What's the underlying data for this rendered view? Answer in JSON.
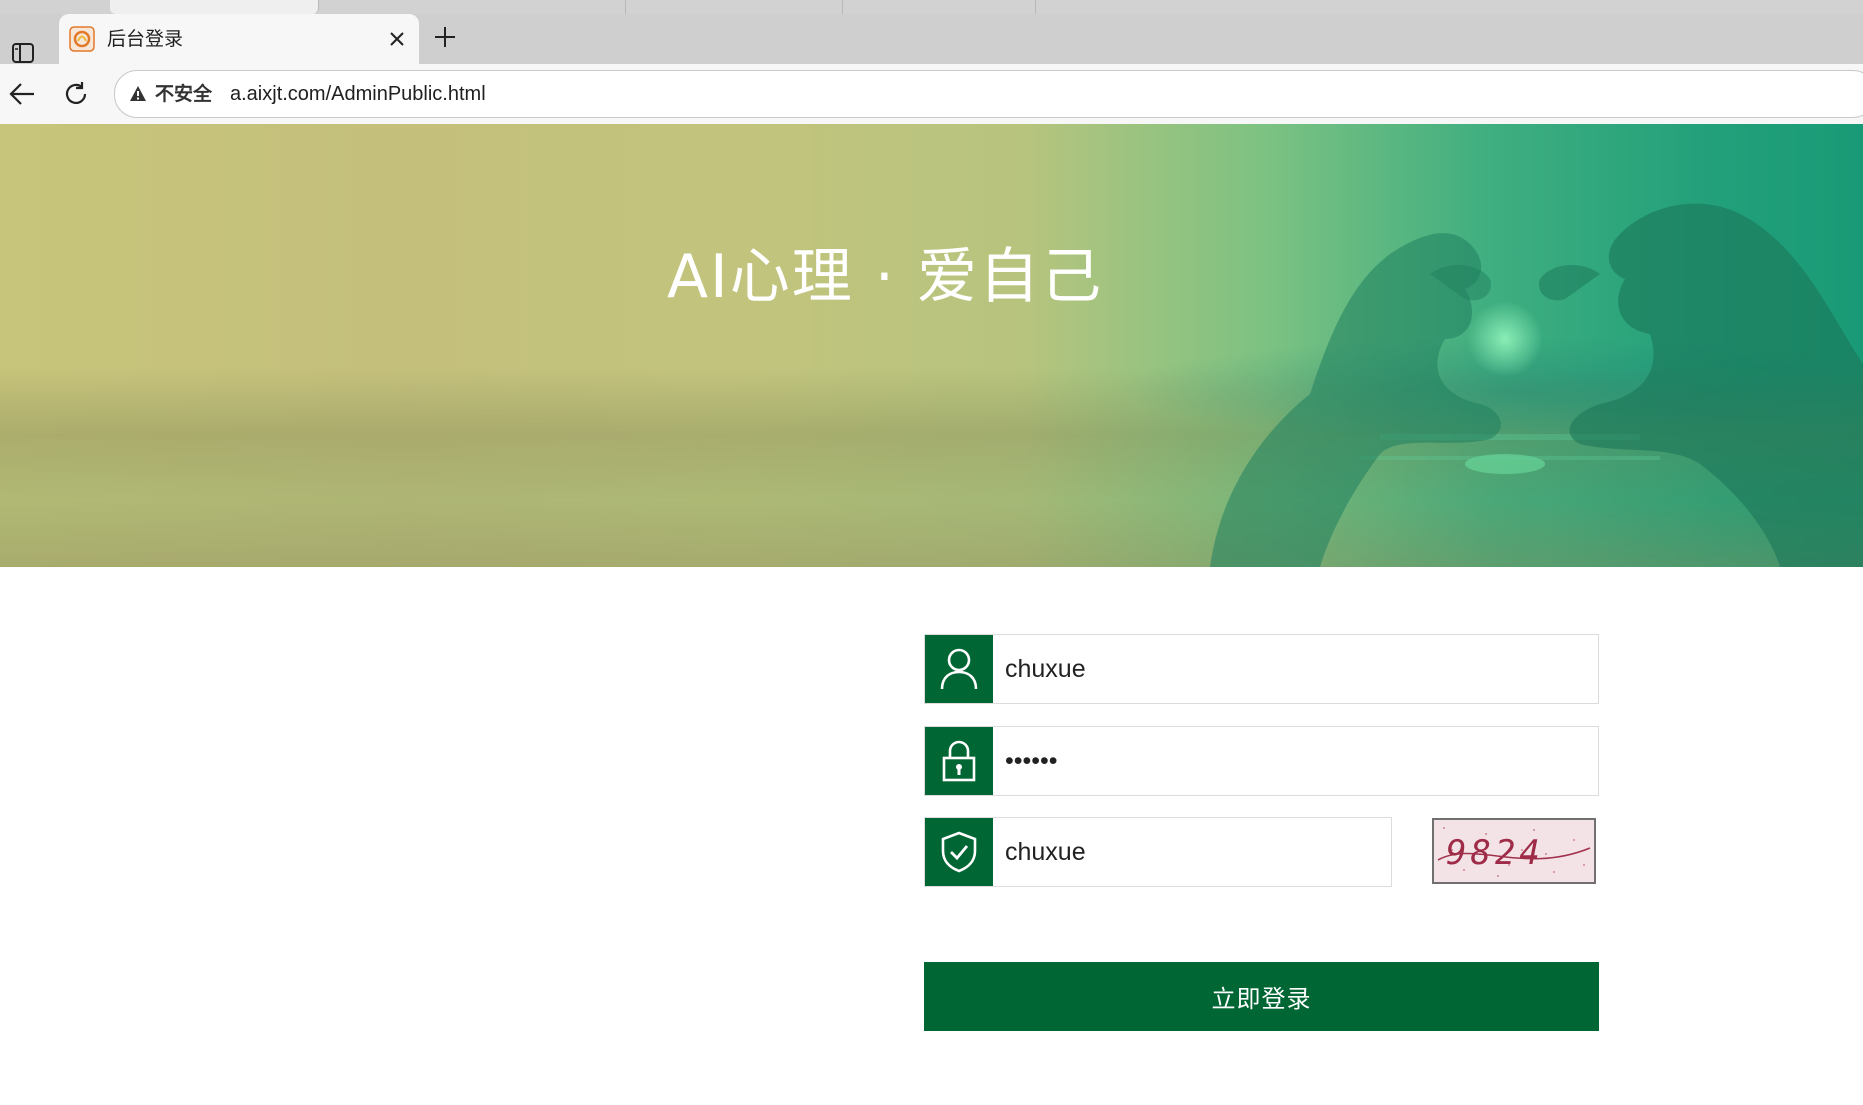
{
  "browser": {
    "tab_title": "后台登录",
    "insecure_label": "不安全",
    "url": "a.aixjt.com/AdminPublic.html"
  },
  "banner": {
    "title": "AI心理 · 爱自己"
  },
  "login_form": {
    "username_value": "chuxue",
    "password_value": "••••••",
    "captcha_value": "chuxue",
    "captcha_image_text": "9824",
    "submit_label": "立即登录"
  },
  "colors": {
    "accent": "#006633"
  }
}
